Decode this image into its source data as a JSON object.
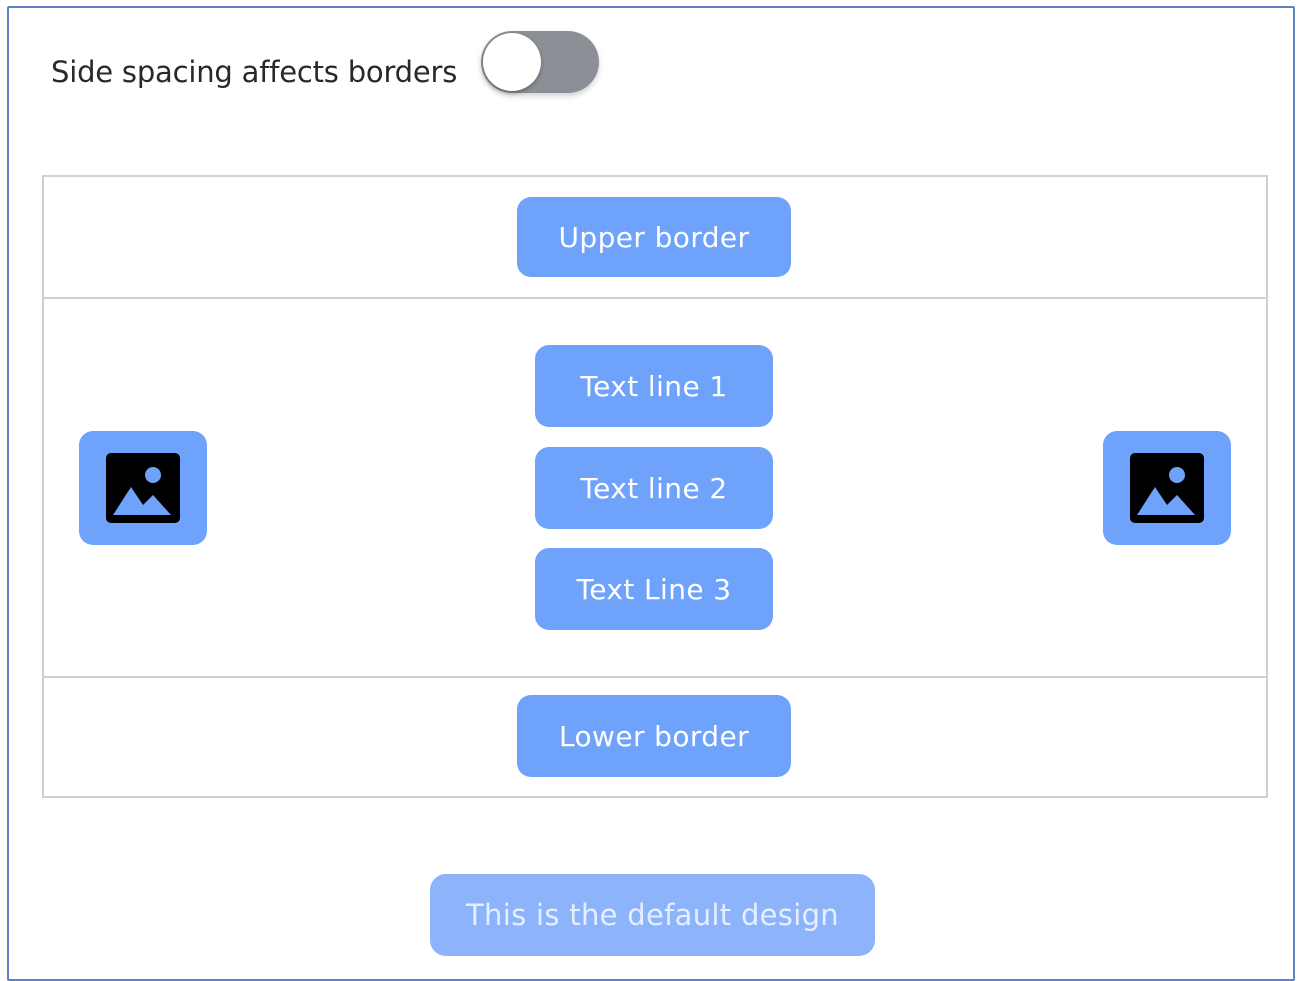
{
  "settings": {
    "toggle_label": "Side spacing affects borders",
    "toggle_on": false
  },
  "preview": {
    "upper_border_label": "Upper border",
    "text_lines": [
      "Text line 1",
      "Text line 2",
      "Text Line 3"
    ],
    "lower_border_label": "Lower border",
    "left_icon": "image-icon",
    "right_icon": "image-icon"
  },
  "default_button_label": "This is the default design",
  "colors": {
    "button_blue": "#6ea2fb",
    "button_blue_light": "#8db3fb",
    "toggle_off": "#8c9096",
    "frame_border": "#5b82c8"
  }
}
